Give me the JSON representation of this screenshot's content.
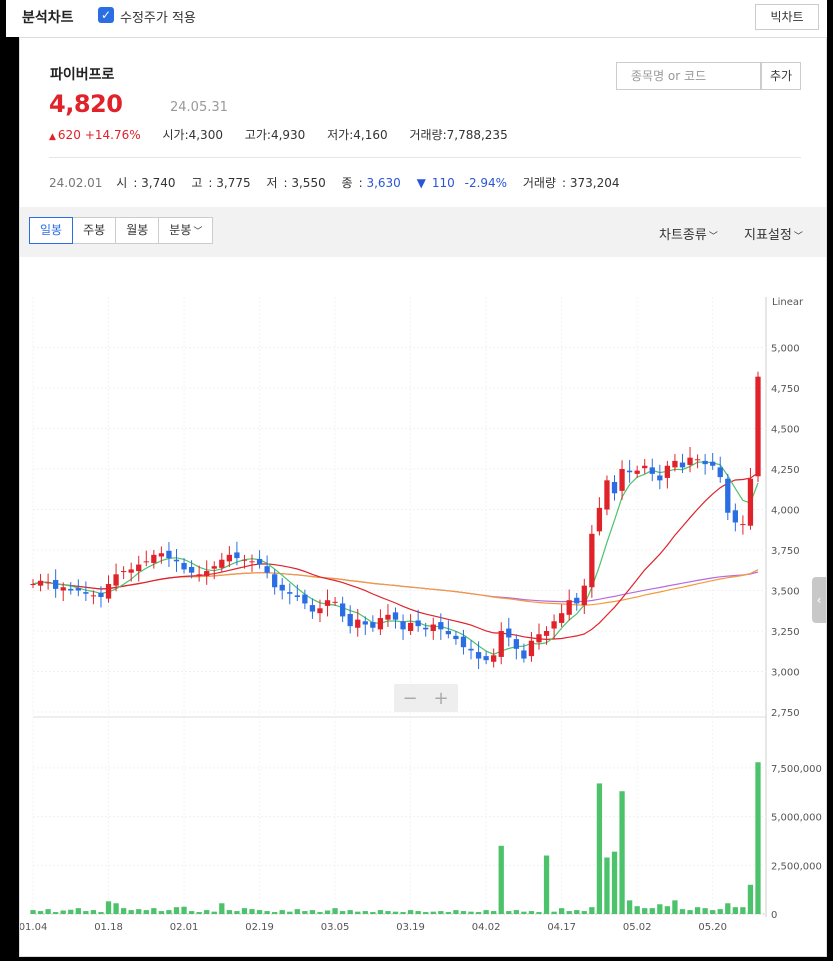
{
  "topbar": {
    "title": "분석차트",
    "adjusted_label": "수정주가 적용",
    "big_chart": "빅차트"
  },
  "stock": {
    "name": "파이버프로",
    "price": "4,820",
    "date": "24.05.31",
    "change": "620",
    "change_pct": "+14.76%",
    "open_label": "시가",
    "open": "4,300",
    "high_label": "고가",
    "high": "4,930",
    "low_label": "저가",
    "low": "4,160",
    "vol_label": "거래량",
    "volume": "7,788,235"
  },
  "search": {
    "placeholder": "종목명 or 코드",
    "add": "추가"
  },
  "hover": {
    "date": "24.02.01",
    "open_label": "시",
    "open": "3,740",
    "high_label": "고",
    "high": "3,775",
    "low_label": "저",
    "low": "3,550",
    "close_label": "종",
    "close": "3,630",
    "change": "110",
    "change_pct": "-2.94%",
    "vol_label": "거래량",
    "volume": "373,204"
  },
  "tabs": [
    "일봉",
    "주봉",
    "월봉",
    "분봉"
  ],
  "menus": {
    "chart_type": "차트종류",
    "indicators": "지표설정"
  },
  "colors": {
    "up": "#e0222b",
    "down": "#2b6ee3",
    "volume": "#4cc26b"
  },
  "chart_data": {
    "type": "candlestick",
    "scale_label": "Linear",
    "y_ticks": [
      2750,
      3000,
      3250,
      3500,
      3750,
      4000,
      4250,
      4500,
      4750,
      5000
    ],
    "ylim": [
      2750,
      5250
    ],
    "vol_ticks": [
      0,
      2500000,
      5000000,
      7500000
    ],
    "vol_labels": [
      "0",
      "2,500,000",
      "5,000,000",
      "7,500,000"
    ],
    "y_labels": [
      "2,750",
      "3,000",
      "3,250",
      "3,500",
      "3,750",
      "4,000",
      "4,250",
      "4,500",
      "4,750",
      "5,000"
    ],
    "x_ticks": [
      "01.04",
      "01.18",
      "02.01",
      "02.19",
      "03.05",
      "03.19",
      "04.02",
      "04.17",
      "05.02",
      "05.20"
    ],
    "x_tick_idx": [
      0,
      10,
      20,
      30,
      40,
      50,
      60,
      70,
      80,
      90
    ],
    "closes": [
      3540,
      3560,
      3550,
      3510,
      3520,
      3500,
      3500,
      3480,
      3470,
      3460,
      3540,
      3600,
      3620,
      3630,
      3660,
      3680,
      3720,
      3730,
      3700,
      3680,
      3630,
      3610,
      3600,
      3620,
      3650,
      3690,
      3720,
      3700,
      3690,
      3680,
      3660,
      3610,
      3520,
      3500,
      3480,
      3460,
      3420,
      3370,
      3390,
      3440,
      3430,
      3340,
      3280,
      3320,
      3290,
      3270,
      3330,
      3350,
      3320,
      3260,
      3300,
      3280,
      3260,
      3290,
      3260,
      3230,
      3200,
      3150,
      3130,
      3080,
      3070,
      3100,
      3250,
      3210,
      3140,
      3080,
      3190,
      3230,
      3250,
      3310,
      3360,
      3440,
      3420,
      3530,
      3850,
      4010,
      4180,
      4100,
      4250,
      4230,
      4240,
      4270,
      4220,
      4180,
      4270,
      4300,
      4260,
      4320,
      4310,
      4280,
      4270,
      4200,
      3980,
      3920,
      3910,
      4190,
      4820
    ],
    "volumes": [
      200000,
      150000,
      250000,
      100000,
      180000,
      220000,
      300000,
      150000,
      200000,
      100000,
      650000,
      550000,
      300000,
      200000,
      250000,
      200000,
      300000,
      150000,
      200000,
      350000,
      373204,
      150000,
      100000,
      200000,
      120000,
      550000,
      200000,
      150000,
      300000,
      250000,
      200000,
      150000,
      100000,
      200000,
      120000,
      250000,
      150000,
      200000,
      100000,
      180000,
      300000,
      150000,
      200000,
      120000,
      150000,
      100000,
      200000,
      150000,
      120000,
      100000,
      200000,
      150000,
      100000,
      120000,
      150000,
      100000,
      200000,
      150000,
      120000,
      100000,
      200000,
      150000,
      3500000,
      150000,
      200000,
      120000,
      150000,
      100000,
      3000000,
      120000,
      300000,
      150000,
      200000,
      150000,
      350000,
      6700000,
      2900000,
      3200000,
      6300000,
      700000,
      400000,
      300000,
      300000,
      500000,
      400000,
      700000,
      250000,
      200000,
      350000,
      300000,
      200000,
      250000,
      550000,
      350000,
      350000,
      1500000,
      7788235
    ],
    "ma5_color": "#4cc26b",
    "ma20_color": "#e0222b",
    "ma60_color": "#f39a3c",
    "ma120_color": "#b56ae0"
  }
}
